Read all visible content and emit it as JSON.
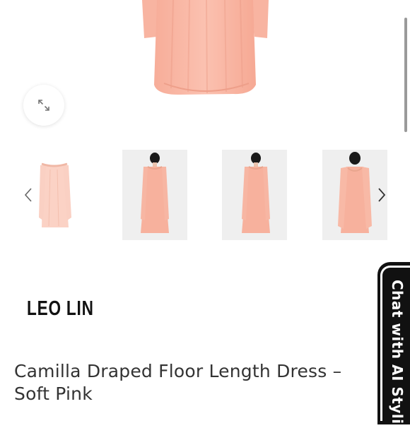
{
  "product": {
    "brand": "LEO LIN",
    "title_line1": "Camilla Draped Floor Length Dress –",
    "title_line2": "Soft Pink"
  },
  "gallery": {
    "expand_icon": "expand-icon",
    "prev_icon": "chevron-left-icon",
    "next_icon": "chevron-right-icon",
    "thumbnail_count": 4
  },
  "chat": {
    "label": "Chat with AI Stylist"
  },
  "colors": {
    "dress_pink": "#f9b7a4",
    "chat_tab": "#111111"
  }
}
